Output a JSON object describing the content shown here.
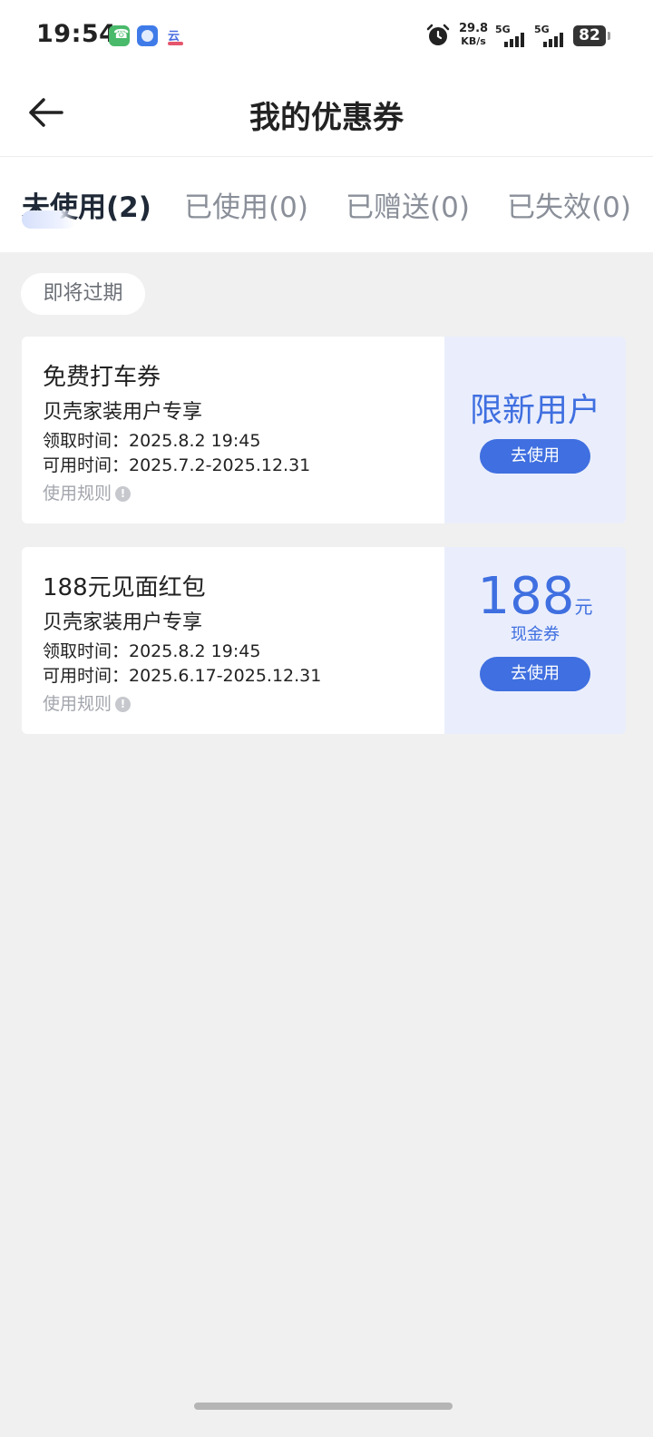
{
  "status_bar": {
    "time": "19:54",
    "net_speed_value": "29.8",
    "net_speed_unit": "KB/s",
    "signal1_label": "5G",
    "signal2_label": "5G",
    "battery": "82"
  },
  "header": {
    "title": "我的优惠券"
  },
  "tabs": [
    {
      "label": "未使用(2)",
      "active": true
    },
    {
      "label": "已使用(0)",
      "active": false
    },
    {
      "label": "已赠送(0)",
      "active": false
    },
    {
      "label": "已失效(0)",
      "active": false
    }
  ],
  "filter_chip": "即将过期",
  "coupons": [
    {
      "name": "免费打车券",
      "subtitle": "贝壳家装用户专享",
      "received": "领取时间：2025.8.2 19:45",
      "valid": "可用时间：2025.7.2-2025.12.31",
      "rules": "使用规则",
      "highlight": "限新用户",
      "button": "去使用"
    },
    {
      "name": "188元见面红包",
      "subtitle": "贝壳家装用户专享",
      "received": "领取时间：2025.8.2 19:45",
      "valid": "可用时间：2025.6.17-2025.12.31",
      "rules": "使用规则",
      "amount": "188",
      "amount_unit": "元",
      "amount_type": "现金券",
      "button": "去使用"
    }
  ],
  "colors": {
    "accent": "#3f6fe0",
    "coupon_right_bg": "#eaeefc",
    "page_bg": "#f0f0f0"
  }
}
